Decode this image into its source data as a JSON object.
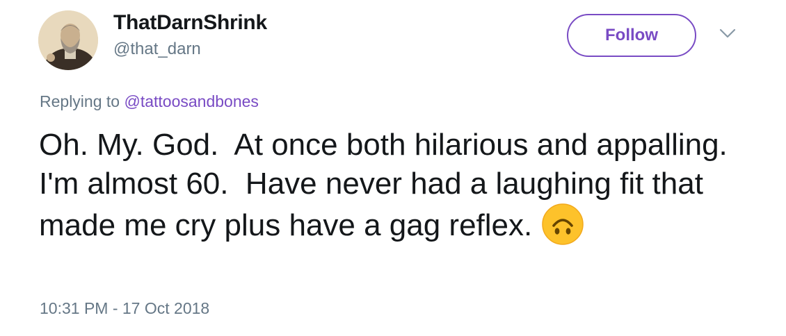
{
  "user": {
    "display_name": "ThatDarnShrink",
    "handle": "@that_darn",
    "avatar_icon": "profile-avatar"
  },
  "actions": {
    "follow_label": "Follow",
    "menu_icon": "chevron-down-icon"
  },
  "reply": {
    "prefix": "Replying to ",
    "target": "@tattoosandbones"
  },
  "tweet": {
    "text": "Oh. My. God.  At once both hilarious and appalling.  I'm almost 60.  Have never had a laughing fit that made me cry plus have a gag reflex. ",
    "emoji": "upside-down-face-emoji"
  },
  "timestamp": "10:31 PM - 17 Oct 2018",
  "colors": {
    "accent": "#794bc4",
    "secondary_text": "#657786",
    "primary_text": "#14171a"
  }
}
